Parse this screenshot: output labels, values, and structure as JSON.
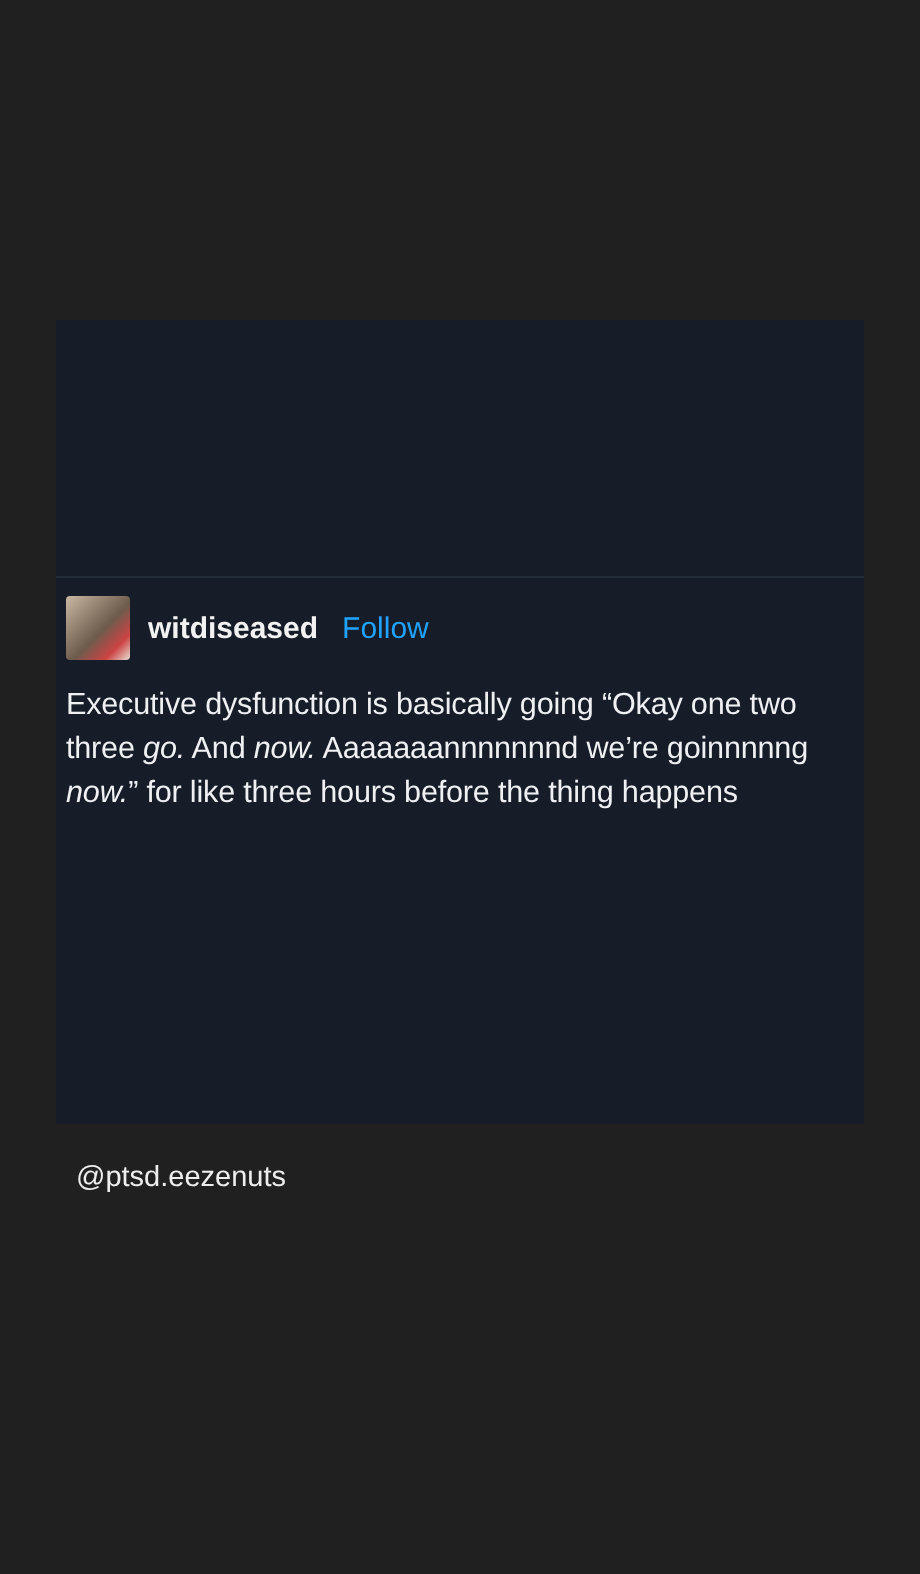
{
  "post": {
    "username": "witdiseased",
    "follow": "Follow",
    "text": "Executive dysfunction is basically going “Okay one two three *go.* And *now.* Aaaaaaannnnnnnd we’re goinnnnng *now.*” for like three hours before the thing happens"
  },
  "caption": "@ptsd.eezenuts"
}
